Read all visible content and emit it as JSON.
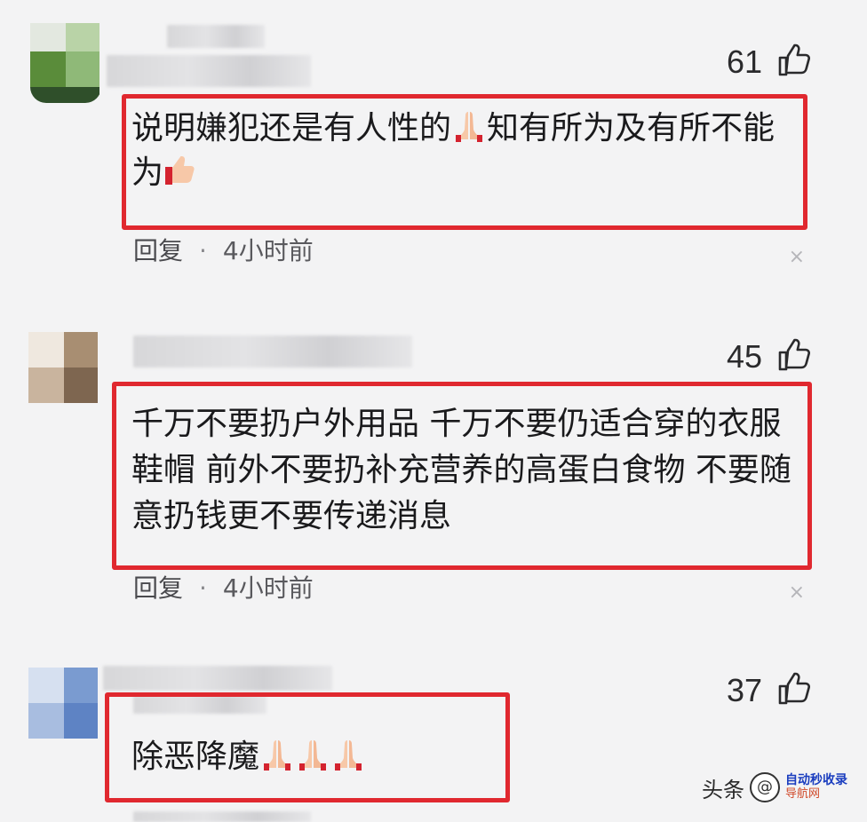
{
  "comments": [
    {
      "likes": "61",
      "text_line1": "说明嫌犯还是有人性的",
      "text_line1b": "知有所为及有所不能",
      "text_line2": "为",
      "reply_label": "回复",
      "separator": "·",
      "time": "4小时前",
      "dismiss": "×",
      "emojis": [
        "folded-hands-emoji",
        "thumbs-up-emoji"
      ]
    },
    {
      "likes": "45",
      "text_line1": "千万不要扔户外用品 千万不要仍适合穿的衣服",
      "text_line2": "鞋帽 前外不要扔补充营养的高蛋白食物 不要随",
      "text_line3": "意扔钱更不要传递消息",
      "reply_label": "回复",
      "separator": "·",
      "time": "4小时前",
      "dismiss": "×"
    },
    {
      "likes": "37",
      "text_line1": "除恶降魔",
      "emojis": [
        "folded-hands-emoji",
        "folded-hands-emoji",
        "folded-hands-emoji"
      ]
    }
  ],
  "watermark": {
    "brand": "头条",
    "logo_glyph": "@",
    "site_line1": "自动秒收录",
    "site_line2": "导航网"
  },
  "colors": {
    "highlight": "#e0282f",
    "background": "#f3f3f4"
  }
}
